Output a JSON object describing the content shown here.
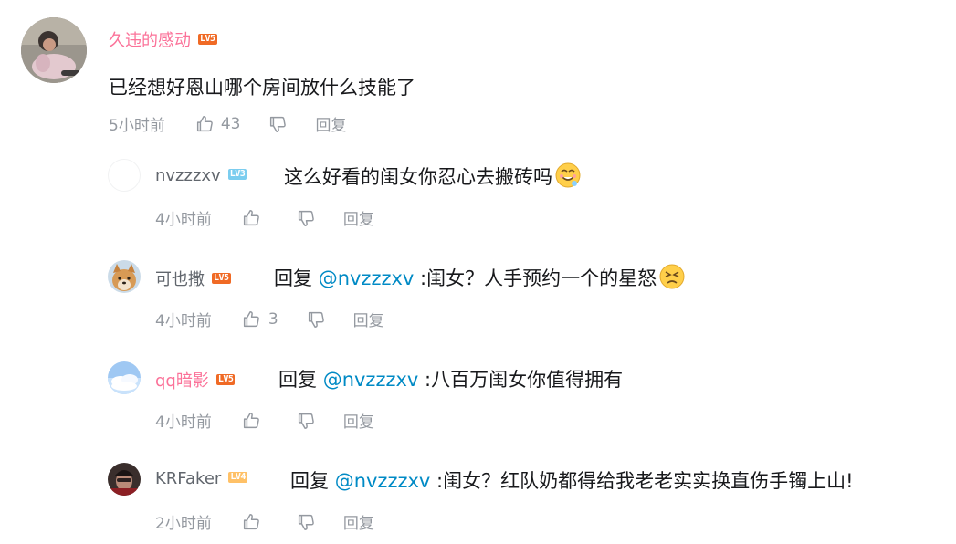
{
  "comments": [
    {
      "user": "久违的感动",
      "level": "LV5",
      "text": "已经想好恩山哪个房间放什么技能了",
      "time": "5小时前",
      "likes": "43",
      "reply_label": "回复"
    }
  ],
  "replies": [
    {
      "user": "nvzzzxv",
      "level": "LV3",
      "text": "这么好看的闺女你忍心去搬砖吗",
      "emoji": "drooling-face",
      "time": "4小时前",
      "likes": "",
      "reply_label": "回复"
    },
    {
      "user": "可也撒",
      "level": "LV5",
      "reply_prefix": "回复 ",
      "mention": "@nvzzzxv",
      "text": " :闺女？人手预约一个的星怒",
      "emoji": "persevering-face",
      "time": "4小时前",
      "likes": "3",
      "reply_label": "回复"
    },
    {
      "user": "qq暗影",
      "level": "LV5",
      "reply_prefix": "回复 ",
      "mention": "@nvzzzxv",
      "text": " :八百万闺女你值得拥有",
      "time": "4小时前",
      "likes": "",
      "reply_label": "回复"
    },
    {
      "user": "KRFaker",
      "level": "LV4",
      "reply_prefix": "回复 ",
      "mention": "@nvzzzxv",
      "text": " :闺女？红队奶都得给我老老实实换直伤手镯上山!",
      "time": "2小时前",
      "likes": "",
      "reply_label": "回复"
    }
  ],
  "colors": {
    "pink_username": "#fb7299",
    "mention_blue": "#008ac5",
    "meta_gray": "#9499a0",
    "lv5": "#f06a25",
    "lv3": "#7bcdef",
    "lv4": "#ffc167"
  }
}
